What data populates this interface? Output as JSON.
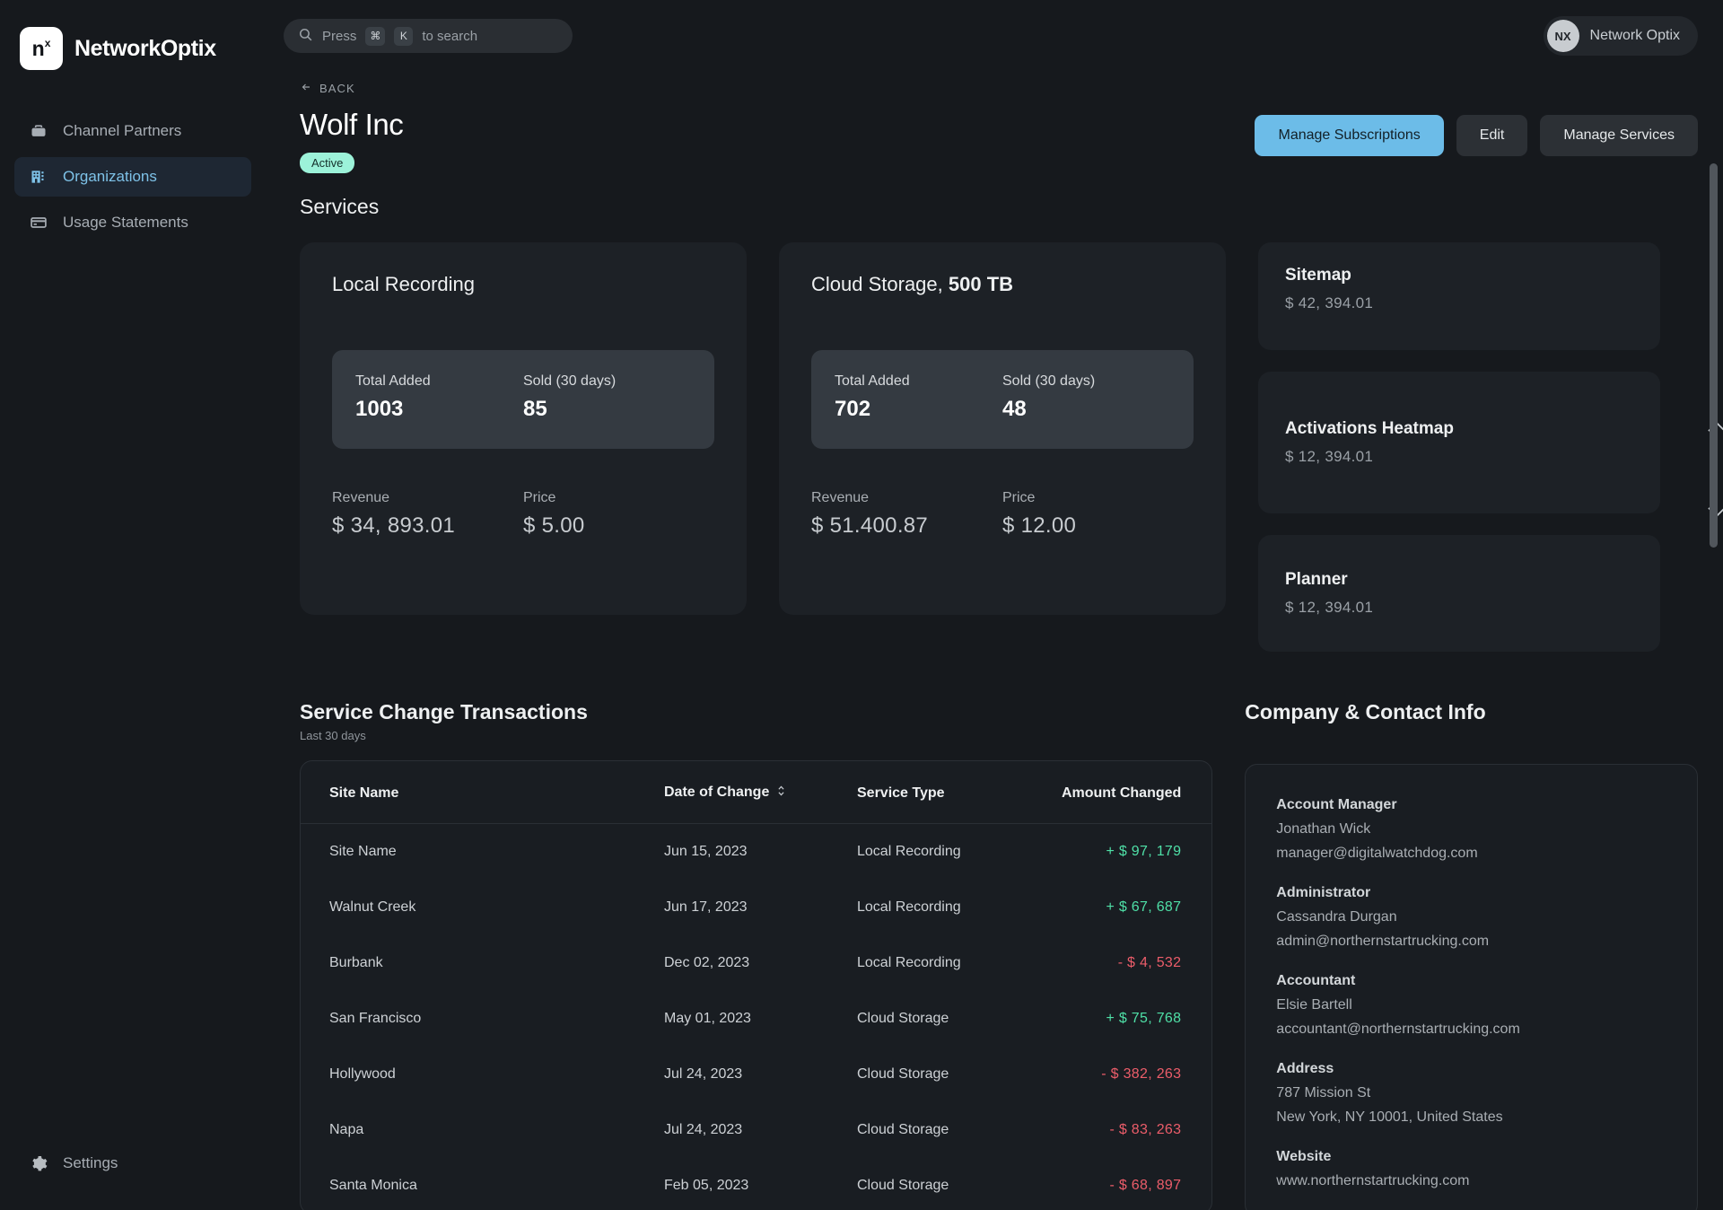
{
  "brand": {
    "logo_text": "n",
    "logo_sup": "x",
    "name": "NetworkOptix"
  },
  "search": {
    "prefix": "Press",
    "key1": "⌘",
    "key2": "K",
    "suffix": "to search"
  },
  "user": {
    "initials": "NX",
    "name": "Network Optix"
  },
  "sidebar": {
    "items": [
      {
        "label": "Channel Partners",
        "icon": "briefcase-icon",
        "active": false
      },
      {
        "label": "Organizations",
        "icon": "building-icon",
        "active": true
      },
      {
        "label": "Usage Statements",
        "icon": "card-icon",
        "active": false
      }
    ],
    "settings": {
      "label": "Settings",
      "icon": "gear-icon"
    }
  },
  "header": {
    "back_label": "BACK",
    "title": "Wolf Inc",
    "status": "Active",
    "status_color": "#9cf2d9",
    "buttons": {
      "primary": "Manage Subscriptions",
      "edit": "Edit",
      "manage": "Manage Services"
    },
    "primary_color": "#6cbce8"
  },
  "services": {
    "section_title": "Services",
    "cards": [
      {
        "name": "Local Recording",
        "name_bold": "",
        "total_added_label": "Total Added",
        "total_added": "1003",
        "sold_label": "Sold (30 days)",
        "sold": "85",
        "revenue_label": "Revenue",
        "revenue": "$ 34, 893.01",
        "price_label": "Price",
        "price": "$ 5.00"
      },
      {
        "name": "Cloud Storage, ",
        "name_bold": "500 TB",
        "total_added_label": "Total Added",
        "total_added": "702",
        "sold_label": "Sold (30 days)",
        "sold": "48",
        "revenue_label": "Revenue",
        "revenue": "$ 51.400.87",
        "price_label": "Price",
        "price": "$ 12.00"
      }
    ],
    "mini": [
      {
        "title": "Sitemap",
        "price": "$ 42, 394.01"
      },
      {
        "title": "Activations Heatmap",
        "price": "$ 12, 394.01"
      },
      {
        "title": "Planner",
        "price": "$ 12, 394.01"
      }
    ],
    "scroll_up": "scroll-up-arrow",
    "scroll_down": "scroll-down-arrow"
  },
  "transactions": {
    "title": "Service Change Transactions",
    "subtitle": "Last 30 days",
    "columns": [
      "Site Name",
      "Date of Change",
      "Service Type",
      "Amount Changed"
    ],
    "rows": [
      {
        "site": "Site Name",
        "date": "Jun 15, 2023",
        "type": "Local Recording",
        "amount": "+ $  97, 179",
        "sign": "pos"
      },
      {
        "site": "Walnut Creek",
        "date": "Jun 17, 2023",
        "type": "Local Recording",
        "amount": "+ $  67, 687",
        "sign": "pos"
      },
      {
        "site": "Burbank",
        "date": "Dec 02, 2023",
        "type": "Local Recording",
        "amount": "- $  4, 532",
        "sign": "neg"
      },
      {
        "site": "San Francisco",
        "date": "May 01, 2023",
        "type": "Cloud Storage",
        "amount": "+ $  75, 768",
        "sign": "pos"
      },
      {
        "site": "Hollywood",
        "date": "Jul 24, 2023",
        "type": "Cloud Storage",
        "amount": "- $  382, 263",
        "sign": "neg"
      },
      {
        "site": "Napa",
        "date": "Jul 24, 2023",
        "type": "Cloud Storage",
        "amount": "- $  83, 263",
        "sign": "neg"
      },
      {
        "site": "Santa Monica",
        "date": "Feb 05, 2023",
        "type": "Cloud Storage",
        "amount": "- $  68, 897",
        "sign": "neg"
      }
    ],
    "positive_color": "#4fe0a7",
    "negative_color": "#ec5d6a"
  },
  "company": {
    "title": "Company & Contact Info",
    "groups": [
      {
        "label": "Account Manager",
        "line1": "Jonathan Wick",
        "line2": "manager@digitalwatchdog.com"
      },
      {
        "label": "Administrator",
        "line1": "Cassandra Durgan",
        "line2": "admin@northernstartrucking.com"
      },
      {
        "label": "Accountant",
        "line1": "Elsie Bartell",
        "line2": "accountant@northernstartrucking.com"
      },
      {
        "label": "Address",
        "line1": "787 Mission St",
        "line2": "New York, NY 10001, United States"
      },
      {
        "label": "Website",
        "line1": "www.northernstartrucking.com",
        "line2": ""
      }
    ]
  }
}
